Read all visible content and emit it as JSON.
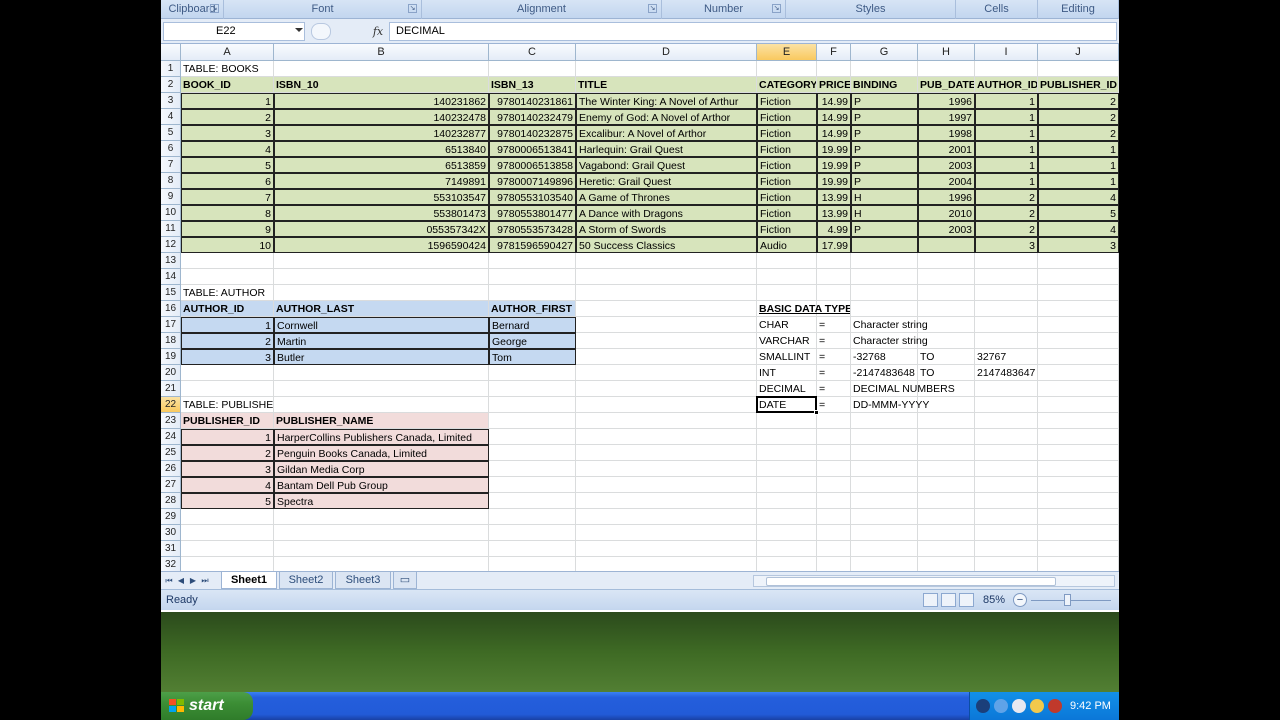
{
  "ribbon_groups": [
    {
      "label": "Clipboard",
      "launcher": true
    },
    {
      "label": "Font",
      "launcher": true
    },
    {
      "label": "Alignment",
      "launcher": true
    },
    {
      "label": "Number",
      "launcher": true
    },
    {
      "label": "Styles",
      "launcher": false
    },
    {
      "label": "Cells",
      "launcher": false
    },
    {
      "label": "Editing",
      "launcher": false
    }
  ],
  "formula_bar": {
    "name_box": "E22",
    "fx_label": "fx",
    "formula": "DECIMAL"
  },
  "columns": [
    "A",
    "B",
    "C",
    "D",
    "E",
    "F",
    "G",
    "H",
    "I",
    "J"
  ],
  "selected_column": "E",
  "selected_row": "22",
  "rows": [
    "1",
    "2",
    "3",
    "4",
    "5",
    "6",
    "7",
    "8",
    "9",
    "10",
    "11",
    "12",
    "13",
    "14",
    "15",
    "16",
    "17",
    "18",
    "19",
    "20",
    "21",
    "22",
    "23",
    "24",
    "25",
    "26",
    "27",
    "28",
    "29",
    "30",
    "31",
    "32"
  ],
  "books": {
    "label": "TABLE: BOOKS",
    "headers": [
      "BOOK_ID",
      "ISBN_10",
      "ISBN_13",
      "TITLE",
      "CATEGORY",
      "PRICE",
      "BINDING",
      "PUB_DATE",
      "AUTHOR_ID",
      "PUBLISHER_ID"
    ],
    "rows": [
      [
        "1",
        "140231862",
        "9780140231861",
        "The Winter King: A Novel of Arthur",
        "Fiction",
        "14.99",
        "P",
        "1996",
        "1",
        "2"
      ],
      [
        "2",
        "140232478",
        "9780140232479",
        "Enemy of God: A Novel of Arthor",
        "Fiction",
        "14.99",
        "P",
        "1997",
        "1",
        "2"
      ],
      [
        "3",
        "140232877",
        "9780140232875",
        "Excalibur: A Novel of Arthor",
        "Fiction",
        "14.99",
        "P",
        "1998",
        "1",
        "2"
      ],
      [
        "4",
        "6513840",
        "9780006513841",
        "Harlequin: Grail Quest",
        "Fiction",
        "19.99",
        "P",
        "2001",
        "1",
        "1"
      ],
      [
        "5",
        "6513859",
        "9780006513858",
        "Vagabond: Grail Quest",
        "Fiction",
        "19.99",
        "P",
        "2003",
        "1",
        "1"
      ],
      [
        "6",
        "7149891",
        "9780007149896",
        "Heretic: Grail Quest",
        "Fiction",
        "19.99",
        "P",
        "2004",
        "1",
        "1"
      ],
      [
        "7",
        "553103547",
        "9780553103540",
        "A Game of Thrones",
        "Fiction",
        "13.99",
        "H",
        "1996",
        "2",
        "4"
      ],
      [
        "8",
        "553801473",
        "9780553801477",
        "A Dance with Dragons",
        "Fiction",
        "13.99",
        "H",
        "2010",
        "2",
        "5"
      ],
      [
        "9",
        "055357342X",
        "9780553573428",
        "A Storm of Swords",
        "Fiction",
        "4.99",
        "P",
        "2003",
        "2",
        "4"
      ],
      [
        "10",
        "1596590424",
        "9781596590427",
        "50 Success Classics",
        "Audio",
        "17.99",
        "",
        "",
        "3",
        "3"
      ]
    ]
  },
  "author": {
    "label": "TABLE: AUTHOR",
    "headers": [
      "AUTHOR_ID",
      "AUTHOR_LAST",
      "AUTHOR_FIRST"
    ],
    "rows": [
      [
        "1",
        "Cornwell",
        "Bernard"
      ],
      [
        "2",
        "Martin",
        "George"
      ],
      [
        "3",
        "Butler",
        "Tom"
      ]
    ]
  },
  "publisher": {
    "label": "TABLE: PUBLISHER",
    "headers": [
      "PUBLISHER_ID",
      "PUBLISHER_NAME"
    ],
    "rows": [
      [
        "1",
        "HarperCollins Publishers Canada, Limited"
      ],
      [
        "2",
        "Penguin Books Canada, Limited"
      ],
      [
        "3",
        "Gildan Media Corp"
      ],
      [
        "4",
        "Bantam Dell Pub Group"
      ],
      [
        "5",
        "Spectra"
      ]
    ]
  },
  "data_types": {
    "title": "BASIC DATA TYPES",
    "rows": [
      [
        "CHAR",
        "=",
        "Character string",
        "",
        ""
      ],
      [
        "VARCHAR",
        "=",
        "Character string",
        "",
        ""
      ],
      [
        "SMALLINT",
        "=",
        "-32768",
        "TO",
        "32767"
      ],
      [
        "INT",
        "=",
        "-2147483648",
        "TO",
        "2147483647"
      ],
      [
        "DECIMAL",
        "=",
        "DECIMAL NUMBERS",
        "",
        ""
      ],
      [
        "DATE",
        "=",
        "DD-MMM-YYYY",
        "",
        ""
      ]
    ]
  },
  "sheet_tabs": [
    "Sheet1",
    "Sheet2",
    "Sheet3"
  ],
  "active_sheet": "Sheet1",
  "status": {
    "text": "Ready",
    "zoom": "85%",
    "zoom_out": "−"
  },
  "taskbar": {
    "start_label": "start",
    "clock": "9:42 PM"
  },
  "colors": {
    "books_fill": "#d7e4bc",
    "author_fill": "#c5d9f1",
    "publisher_fill": "#f2dcdb",
    "selection_header": "#f9c95f"
  }
}
